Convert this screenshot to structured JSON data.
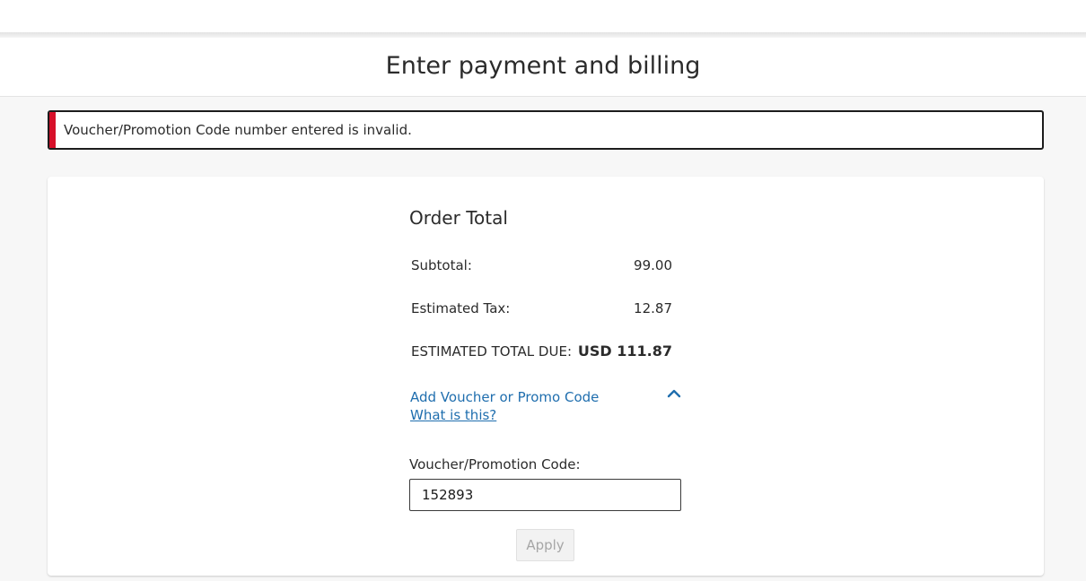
{
  "page": {
    "title": "Enter payment and billing"
  },
  "alert": {
    "message": "Voucher/Promotion Code number entered is invalid.",
    "accent_color": "#d7102a"
  },
  "order": {
    "title": "Order Total",
    "rows": [
      {
        "label": "Subtotal:",
        "value": "99.00"
      },
      {
        "label": "Estimated Tax:",
        "value": "12.87"
      },
      {
        "label": "ESTIMATED TOTAL DUE:",
        "value": "USD 111.87"
      }
    ]
  },
  "promo": {
    "toggle_label": "Add Voucher or Promo Code",
    "help_link": "What is this?",
    "toggle_icon": "chevron-up-icon",
    "field_label": "Voucher/Promotion Code:",
    "field_value": "152893",
    "apply_label": "Apply",
    "link_color": "#1f6eae"
  }
}
